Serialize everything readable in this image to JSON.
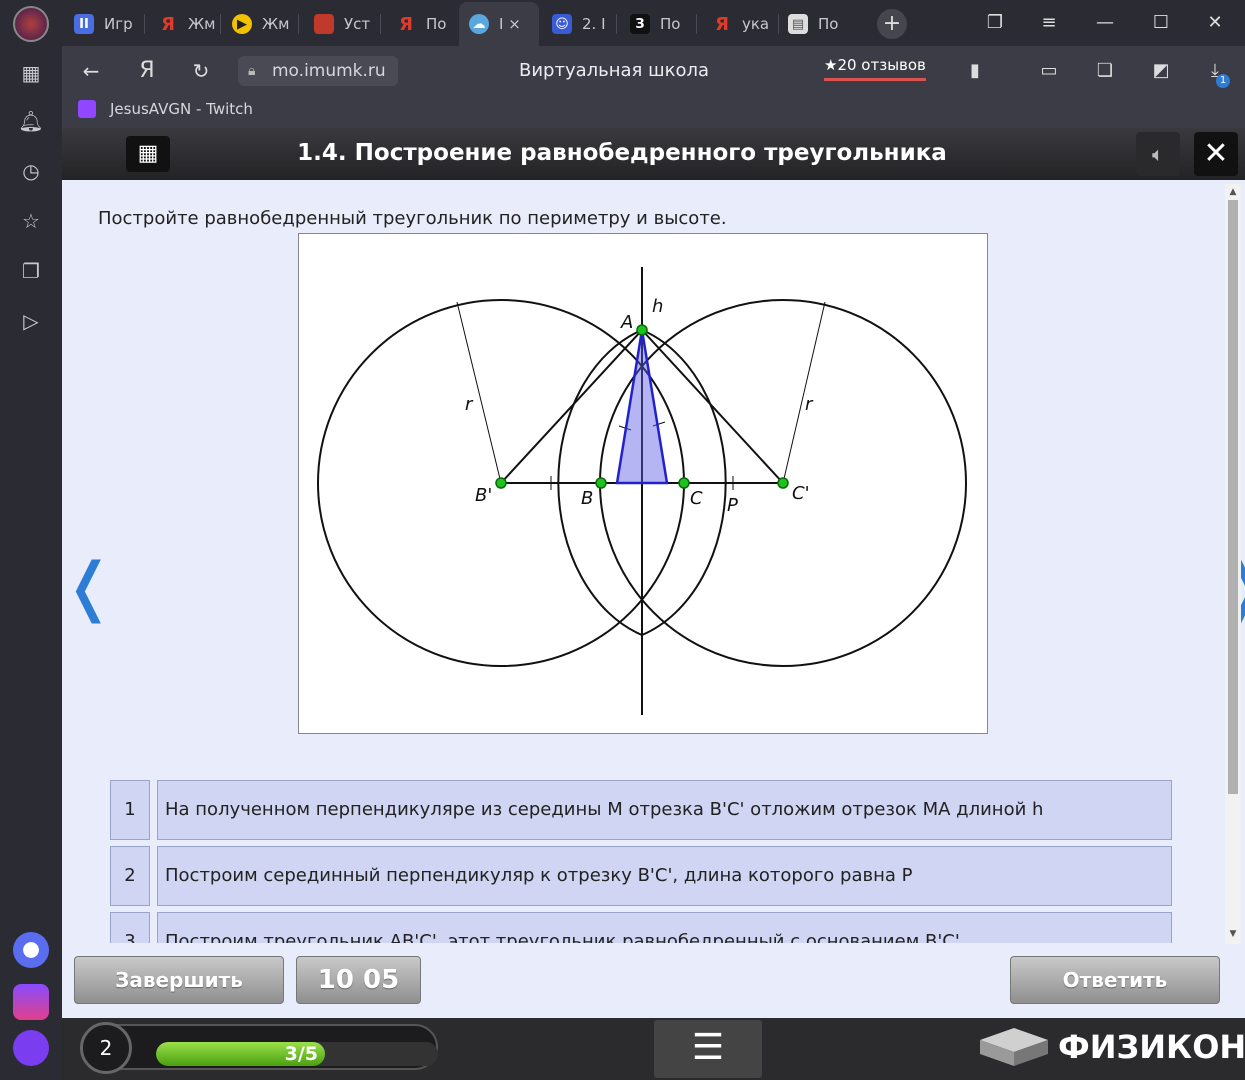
{
  "browser": {
    "tabs": [
      {
        "label": "Игр",
        "icon": "pause-icon",
        "color": "#4a6ee0"
      },
      {
        "label": "Жм",
        "icon": "yandex-icon",
        "color": "#e03a2a"
      },
      {
        "label": "Жм",
        "icon": "play-icon",
        "color": "#f2c200"
      },
      {
        "label": "Уст",
        "icon": "page-icon",
        "color": "#c0392b"
      },
      {
        "label": "По",
        "icon": "yandex-icon",
        "color": "#e03a2a"
      },
      {
        "label": "I ×",
        "icon": "cloud-icon",
        "color": "#5aa7e0"
      },
      {
        "label": "2. I",
        "icon": "cat-icon",
        "color": "#3a5bd6"
      },
      {
        "label": "По",
        "icon": "z-icon",
        "color": "#111111"
      },
      {
        "label": "ука",
        "icon": "yandex-icon",
        "color": "#e03a2a"
      },
      {
        "label": "По",
        "icon": "doc-icon",
        "color": "#dddddd"
      }
    ],
    "url": "mo.imumk.ru",
    "page_title": "Виртуальная школа",
    "reviews": "★20 отзывов",
    "bookmark": "JesusAVGN - Twitch",
    "download_badge": "1"
  },
  "app": {
    "title": "1.4. Построение равнобедренного треугольника",
    "question": "Постройте равнобедренный треугольник по периметру и высоте.",
    "figure_labels": {
      "A": "A",
      "h": "h",
      "r_left": "r",
      "r_right": "r",
      "B_prime": "B'",
      "B": "B",
      "C": "C",
      "P": "P",
      "C_prime": "C'"
    },
    "steps": [
      {
        "num": "1",
        "text": "На полученном перпендикуляре из середины M отрезка B'C' отложим отрезок MA длиной h"
      },
      {
        "num": "2",
        "text": "Построим серединный перпендикуляр к отрезку B'C', длина которого равна P"
      },
      {
        "num": "3",
        "text": "Построим треугольник AB'C', этот треугольник равнобедренный с основанием B'C'"
      }
    ],
    "buttons": {
      "finish": "Завершить",
      "timer": "10 05",
      "answer": "Ответить"
    },
    "nav": {
      "prev": "❬",
      "next": "❭"
    },
    "footer": {
      "level": "2",
      "progress": "3/5",
      "progress_fraction": 0.6,
      "brand": "ФИЗИКОН"
    }
  }
}
